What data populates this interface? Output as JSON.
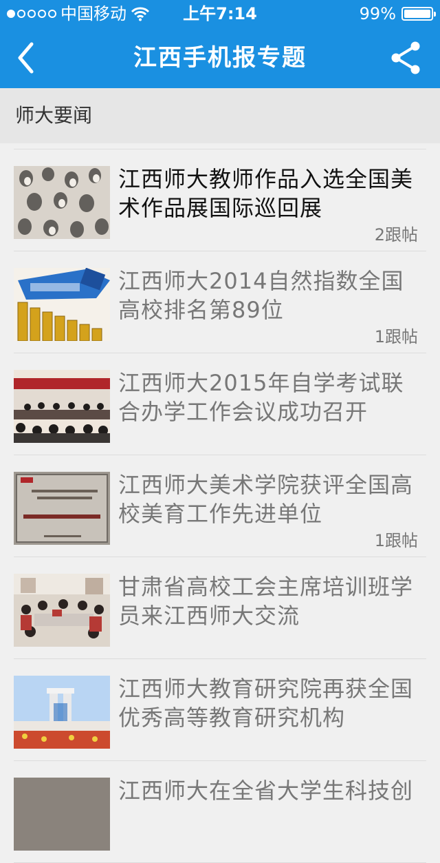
{
  "status_bar": {
    "carrier": "中国移动",
    "time": "上午7:14",
    "battery_text": "99%",
    "battery_level_percent": 99,
    "signal_bars_filled": 1,
    "signal_bars_total": 5,
    "wifi_icon": "wifi-icon"
  },
  "nav": {
    "title": "江西手机报专题",
    "back_icon": "chevron-left-icon",
    "share_icon": "share-icon"
  },
  "section": {
    "title": "师大要闻"
  },
  "articles": [
    {
      "headline": "江西师大教师作品入选全国美术作品展国际巡回展",
      "replies": "2跟帖"
    },
    {
      "headline": "江西师大2014自然指数全国高校排名第89位",
      "replies": "1跟帖"
    },
    {
      "headline": "江西师大2015年自学考试联合办学工作会议成功召开",
      "replies": ""
    },
    {
      "headline": "江西师大美术学院获评全国高校美育工作先进单位",
      "replies": "1跟帖"
    },
    {
      "headline": "甘肃省高校工会主席培训班学员来江西师大交流",
      "replies": ""
    },
    {
      "headline": "江西师大教育研究院再获全国优秀高等教育研究机构",
      "replies": ""
    },
    {
      "headline": "江西师大在全省大学生科技创",
      "replies": ""
    }
  ],
  "colors": {
    "header_bg": "#1a90e1",
    "section_bg": "#e6e6e6",
    "page_bg": "#f0f0f0",
    "read_headline": "#777777",
    "unread_headline": "#111111"
  }
}
